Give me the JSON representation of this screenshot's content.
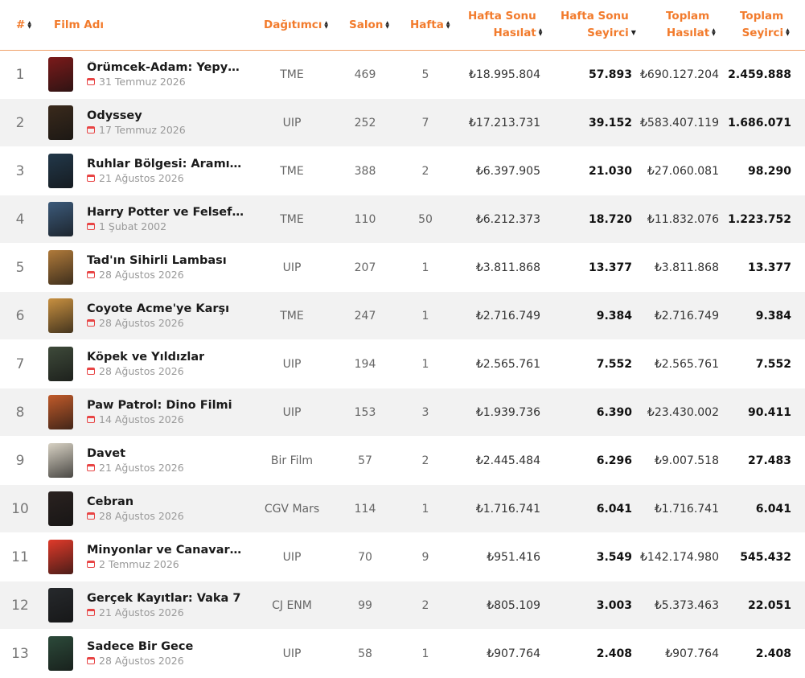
{
  "header": {
    "rank": "#",
    "film": "Film Adı",
    "distributor": "Dağıtımcı",
    "salon": "Salon",
    "week": "Hafta",
    "weekend_gross_1": "Hafta Sonu",
    "weekend_gross_2": "Hasılat",
    "weekend_adm_1": "Hafta Sonu",
    "weekend_adm_2": "Seyirci",
    "total_gross_1": "Toplam",
    "total_gross_2": "Hasılat",
    "total_adm_1": "Toplam",
    "total_adm_2": "Seyirci"
  },
  "colors": {
    "accent": "#f27b2c",
    "calendar": "#e84545",
    "row_alt": "#f2f2f2"
  },
  "rows": [
    {
      "rank": "1",
      "title": "Örümcek-Adam: Yepye...",
      "date": "31 Temmuz 2026",
      "distributor": "TME",
      "salon": "469",
      "week": "5",
      "weekend_gross": "₺18.995.804",
      "weekend_adm": "57.893",
      "total_gross": "₺690.127.204",
      "total_adm": "2.459.888",
      "poster_color": "#7b1a1a"
    },
    {
      "rank": "2",
      "title": "Odyssey",
      "date": "17 Temmuz 2026",
      "distributor": "UIP",
      "salon": "252",
      "week": "7",
      "weekend_gross": "₺17.213.731",
      "weekend_adm": "39.152",
      "total_gross": "₺583.407.119",
      "total_adm": "1.686.071",
      "poster_color": "#3a2a1c"
    },
    {
      "rank": "3",
      "title": "Ruhlar Bölgesi: Aramızd...",
      "date": "21 Ağustos 2026",
      "distributor": "TME",
      "salon": "388",
      "week": "2",
      "weekend_gross": "₺6.397.905",
      "weekend_adm": "21.030",
      "total_gross": "₺27.060.081",
      "total_adm": "98.290",
      "poster_color": "#22384a"
    },
    {
      "rank": "4",
      "title": "Harry Potter ve Felsefe T...",
      "date": "1 Şubat 2002",
      "distributor": "TME",
      "salon": "110",
      "week": "50",
      "weekend_gross": "₺6.212.373",
      "weekend_adm": "18.720",
      "total_gross": "₺11.832.076",
      "total_adm": "1.223.752",
      "poster_color": "#3c5a7a"
    },
    {
      "rank": "5",
      "title": "Tad'ın Sihirli Lambası",
      "date": "28 Ağustos 2026",
      "distributor": "UIP",
      "salon": "207",
      "week": "1",
      "weekend_gross": "₺3.811.868",
      "weekend_adm": "13.377",
      "total_gross": "₺3.811.868",
      "total_adm": "13.377",
      "poster_color": "#b07a3a"
    },
    {
      "rank": "6",
      "title": "Coyote Acme'ye Karşı",
      "date": "28 Ağustos 2026",
      "distributor": "TME",
      "salon": "247",
      "week": "1",
      "weekend_gross": "₺2.716.749",
      "weekend_adm": "9.384",
      "total_gross": "₺2.716.749",
      "total_adm": "9.384",
      "poster_color": "#c89040"
    },
    {
      "rank": "7",
      "title": "Köpek ve Yıldızlar",
      "date": "28 Ağustos 2026",
      "distributor": "UIP",
      "salon": "194",
      "week": "1",
      "weekend_gross": "₺2.565.761",
      "weekend_adm": "7.552",
      "total_gross": "₺2.565.761",
      "total_adm": "7.552",
      "poster_color": "#3e4a3a"
    },
    {
      "rank": "8",
      "title": "Paw Patrol: Dino Filmi",
      "date": "14 Ağustos 2026",
      "distributor": "UIP",
      "salon": "153",
      "week": "3",
      "weekend_gross": "₺1.939.736",
      "weekend_adm": "6.390",
      "total_gross": "₺23.430.002",
      "total_adm": "90.411",
      "poster_color": "#c05a2a"
    },
    {
      "rank": "9",
      "title": "Davet",
      "date": "21 Ağustos 2026",
      "distributor": "Bir Film",
      "salon": "57",
      "week": "2",
      "weekend_gross": "₺2.445.484",
      "weekend_adm": "6.296",
      "total_gross": "₺9.007.518",
      "total_adm": "27.483",
      "poster_color": "#d8d2c4"
    },
    {
      "rank": "10",
      "title": "Cebran",
      "date": "28 Ağustos 2026",
      "distributor": "CGV Mars",
      "salon": "114",
      "week": "1",
      "weekend_gross": "₺1.716.741",
      "weekend_adm": "6.041",
      "total_gross": "₺1.716.741",
      "total_adm": "6.041",
      "poster_color": "#2a2220"
    },
    {
      "rank": "11",
      "title": "Minyonlar ve Canavarlar",
      "date": "2 Temmuz 2026",
      "distributor": "UIP",
      "salon": "70",
      "week": "9",
      "weekend_gross": "₺951.416",
      "weekend_adm": "3.549",
      "total_gross": "₺142.174.980",
      "total_adm": "545.432",
      "poster_color": "#e03a2a"
    },
    {
      "rank": "12",
      "title": "Gerçek Kayıtlar: Vaka 7",
      "date": "21 Ağustos 2026",
      "distributor": "CJ ENM",
      "salon": "99",
      "week": "2",
      "weekend_gross": "₺805.109",
      "weekend_adm": "3.003",
      "total_gross": "₺5.373.463",
      "total_adm": "22.051",
      "poster_color": "#26292c"
    },
    {
      "rank": "13",
      "title": "Sadece Bir Gece",
      "date": "28 Ağustos 2026",
      "distributor": "UIP",
      "salon": "58",
      "week": "1",
      "weekend_gross": "₺907.764",
      "weekend_adm": "2.408",
      "total_gross": "₺907.764",
      "total_adm": "2.408",
      "poster_color": "#2c4a3a"
    }
  ]
}
